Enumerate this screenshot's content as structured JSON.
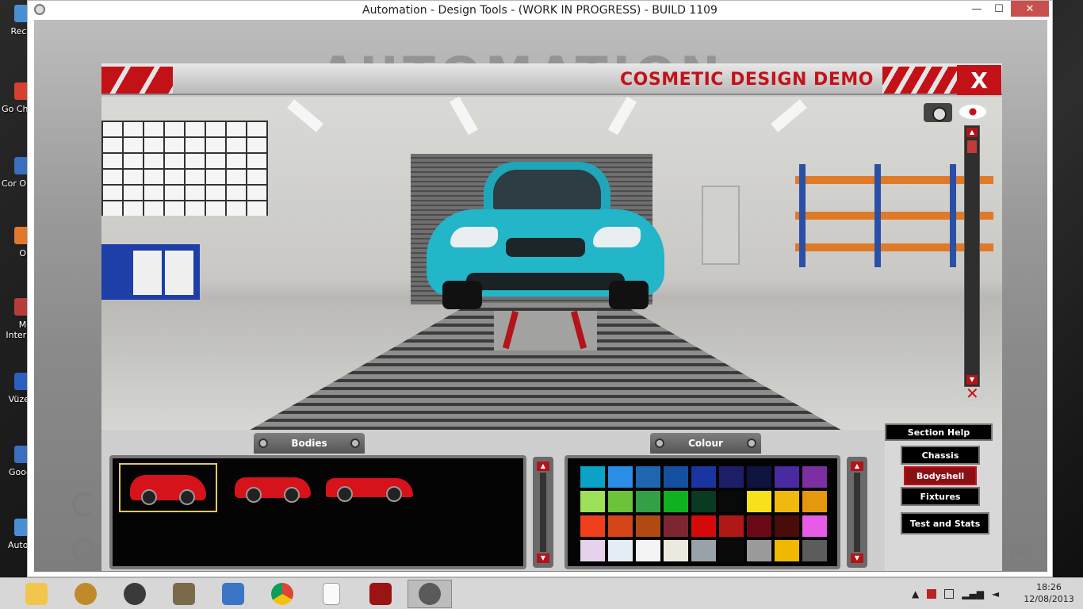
{
  "window": {
    "title": "Automation - Design Tools - (WORK IN PROGRESS) - BUILD 1109",
    "minimize": "—",
    "maximize": "☐",
    "close": "✕"
  },
  "desktop_icons": [
    {
      "label": "Recy",
      "icon": "recycle-bin-icon",
      "color": "#4a8fd4"
    },
    {
      "label": "Go Chr",
      "icon": "google-chrome-shortcut-icon",
      "color": "#d6412f"
    },
    {
      "label": "Cor On",
      "icon": "shortcut-icon",
      "color": "#3a6fbf"
    },
    {
      "label": "On",
      "icon": "shortcut-icon",
      "color": "#e2782b"
    },
    {
      "label": "Mo Intern",
      "icon": "internet-shortcut-icon",
      "color": "#b93c3c"
    },
    {
      "label": "Vüzel",
      "icon": "shortcut-icon",
      "color": "#2b5fc0"
    },
    {
      "label": "Goog",
      "icon": "google-shortcut-icon",
      "color": "#3a6fbf"
    },
    {
      "label": "Autor",
      "icon": "automation-shortcut-icon",
      "color": "#4a8fd4"
    }
  ],
  "background": {
    "logo": "AUTOMATION",
    "left_text_1": "C",
    "left_text_2": "O",
    "right_text": "me"
  },
  "game": {
    "header_title": "COSMETIC DESIGN DEMO",
    "close_label": "X",
    "bodies_tab": "Bodies",
    "colour_tab": "Colour",
    "bodies": [
      {
        "name": "hatchback",
        "selected": true
      },
      {
        "name": "coupe",
        "selected": false
      },
      {
        "name": "sports",
        "selected": false
      }
    ],
    "colours": [
      "#0aa3c6",
      "#2b8ee6",
      "#1f66b0",
      "#1450a0",
      "#1a35a0",
      "#1c1f66",
      "#0e1340",
      "#4a2aa0",
      "#7b2fa0",
      "#9ee05a",
      "#6cc23a",
      "#34a045",
      "#10b020",
      "#0a3a22",
      "#060a08",
      "#f7e11c",
      "#f0b90e",
      "#e5980e",
      "#ef3f1c",
      "#d5461a",
      "#b04a12",
      "#7e2630",
      "#d40a0a",
      "#b01717",
      "#6a0a18",
      "#4a0b0b",
      "#e65ce6",
      "#e6d2ec",
      "#e4ecf4",
      "#f3f3f3",
      "#eceade",
      "#98a2a8",
      "#0a0a0a",
      "#9a9a9a",
      "#f0b800",
      "#5c5c5c"
    ],
    "menu": {
      "section_help": "Section Help",
      "chassis": "Chassis",
      "bodyshell": "Bodyshell",
      "fixtures": "Fixtures",
      "test_stats": "Test and Stats"
    }
  },
  "taskbar": {
    "items": [
      "file-explorer-icon",
      "app-icon",
      "speaker-icon",
      "doc-icon",
      "settings-icon",
      "chrome-icon",
      "blank-file-icon",
      "power-app-icon",
      "automation-app-icon"
    ],
    "time": "18:26",
    "date": "12/08/2013"
  }
}
